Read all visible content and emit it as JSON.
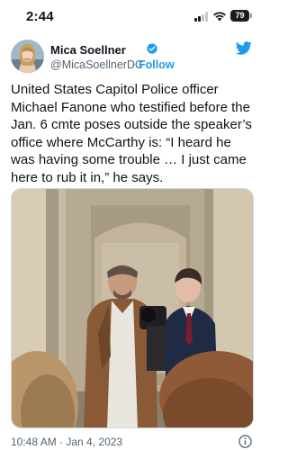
{
  "status_bar": {
    "time": "2:44",
    "battery_level": "79"
  },
  "author": {
    "name": "Mica Soellner",
    "handle": "@MicaSoellnerDC",
    "separator": "·",
    "follow_label": "Follow",
    "verified": true
  },
  "tweet": {
    "text": "United States Capitol Police officer Michael Fanone who testified before the Jan. 6 cmte poses outside the speaker’s office where McCarthy is: “I heard he was having some trouble … I just came here to rub it in,” he says.",
    "timestamp": "10:48 AM · Jan 4, 2023",
    "media": {
      "type": "photo",
      "description_icon": "photo"
    }
  },
  "icons": {
    "verified": "verified-badge-icon",
    "brand": "twitter-bird-icon",
    "info": "info-icon"
  },
  "colors": {
    "accent": "#1d9bf0",
    "secondary_text": "#536471",
    "primary_text": "#0f1419"
  }
}
